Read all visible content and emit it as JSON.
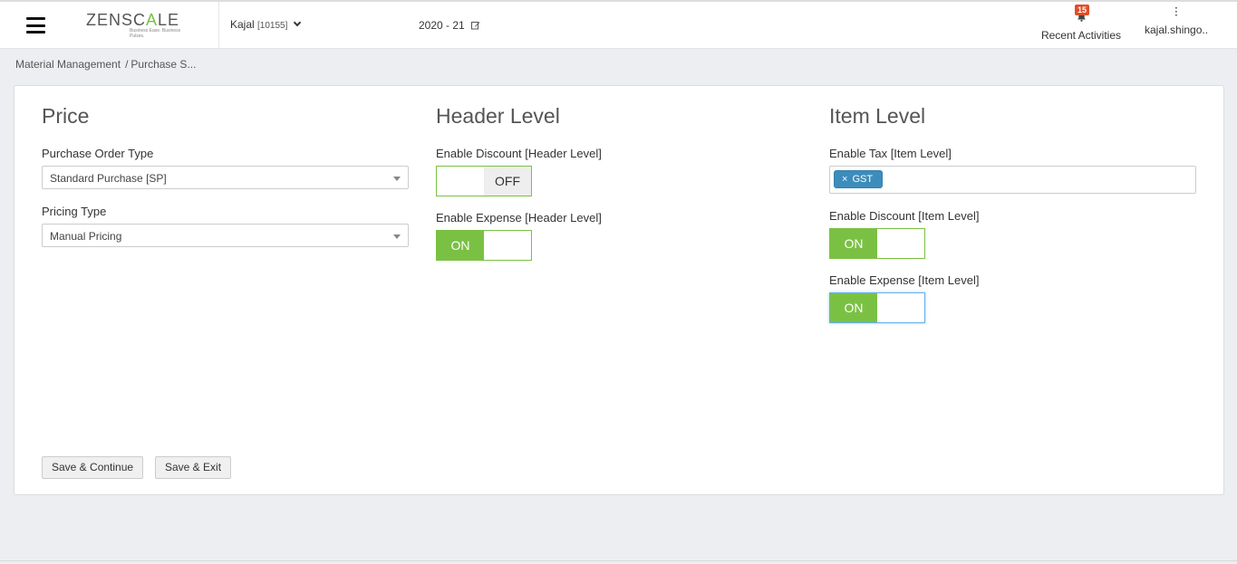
{
  "header": {
    "logo_main": "ZENSC",
    "logo_accent": "A",
    "logo_end": "LE",
    "logo_tagline": "Business Ease. Business Pulses.",
    "company_name": "Kajal",
    "company_code": "[10155]",
    "fiscal_year": "2020 - 21",
    "notifications_count": "15",
    "recent_activities_label": "Recent Activities",
    "user_name": "kajal.shingo.."
  },
  "breadcrumb": {
    "items": [
      "Material Management",
      "Purchase S..."
    ],
    "separator": "/"
  },
  "price": {
    "title": "Price",
    "purchase_order_type_label": "Purchase Order Type",
    "purchase_order_type_value": "Standard Purchase [SP]",
    "pricing_type_label": "Pricing Type",
    "pricing_type_value": "Manual Pricing"
  },
  "header_level": {
    "title": "Header Level",
    "enable_discount_label": "Enable Discount [Header Level]",
    "enable_discount_state": "OFF",
    "enable_expense_label": "Enable Expense [Header Level]",
    "enable_expense_state": "ON"
  },
  "item_level": {
    "title": "Item Level",
    "enable_tax_label": "Enable Tax [Item Level]",
    "tax_tags": [
      "GST"
    ],
    "tag_remove_symbol": "×",
    "enable_discount_label": "Enable Discount [Item Level]",
    "enable_discount_state": "ON",
    "enable_expense_label": "Enable Expense [Item Level]",
    "enable_expense_state": "ON"
  },
  "actions": {
    "save_continue": "Save & Continue",
    "save_exit": "Save & Exit"
  },
  "colors": {
    "accent_green": "#7ac143",
    "tag_blue": "#3c8dbc",
    "badge_red": "#e14d2a"
  }
}
